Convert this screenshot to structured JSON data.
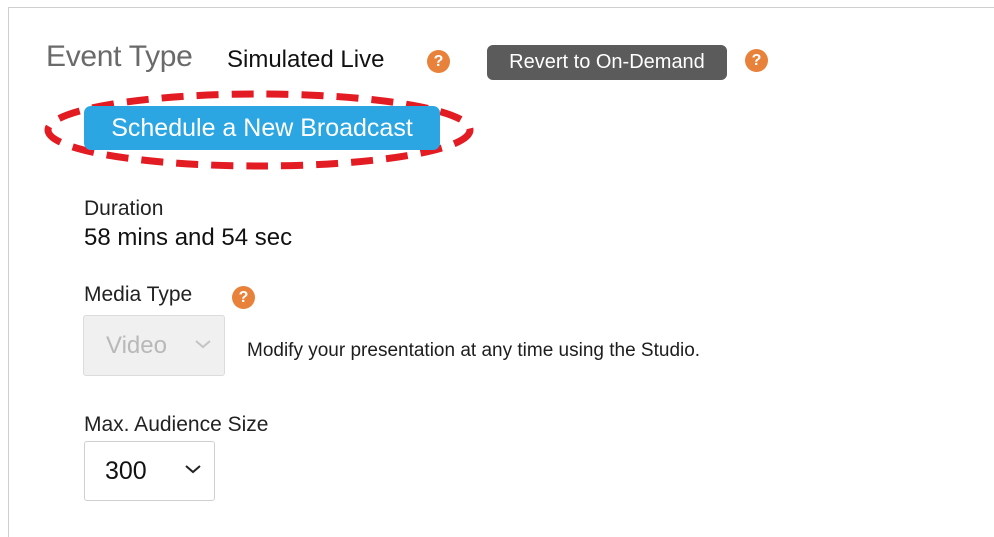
{
  "event_type": {
    "label": "Event Type",
    "value": "Simulated Live",
    "help_icon": "?",
    "revert_label": "Revert to On-Demand"
  },
  "schedule": {
    "button_label": "Schedule a New Broadcast",
    "highlight_color": "#e31b23"
  },
  "duration": {
    "label": "Duration",
    "value": "58 mins and 54 sec"
  },
  "media_type": {
    "label": "Media Type",
    "help_icon": "?",
    "selected": "Video",
    "hint": "Modify your presentation at any time using the Studio."
  },
  "audience": {
    "label": "Max. Audience Size",
    "selected": "300"
  },
  "colors": {
    "help_orange": "#e8813a",
    "button_blue": "#2ba6e3",
    "revert_gray": "#5b5b5b"
  }
}
